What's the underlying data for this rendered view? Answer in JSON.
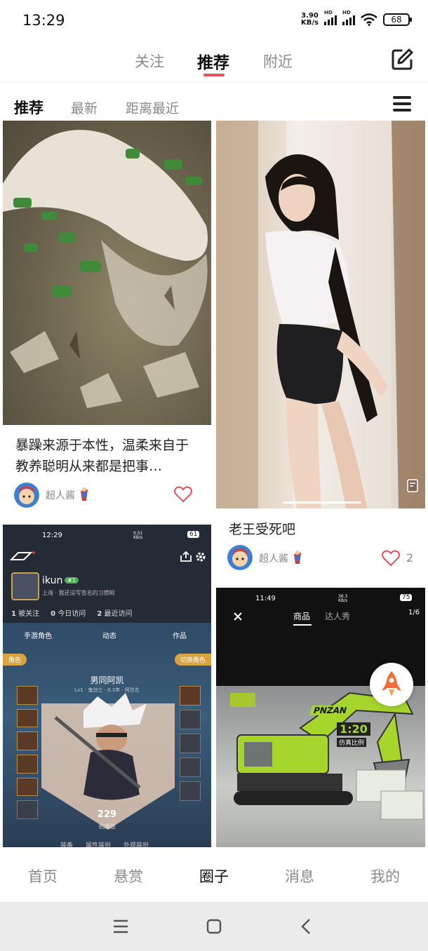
{
  "status_bar": {
    "time": "13:29",
    "net_speed_value": "3.90",
    "net_speed_unit": "KB/s",
    "hd_label": "HD",
    "battery": "68"
  },
  "top_tabs": [
    {
      "label": "关注"
    },
    {
      "label": "推荐"
    },
    {
      "label": "附近"
    }
  ],
  "sub_tabs": [
    {
      "label": "推荐"
    },
    {
      "label": "最新"
    },
    {
      "label": "距离最近"
    }
  ],
  "accent_color": "#e8505b",
  "cards": [
    {
      "title": "暴躁来源于本性，温柔来自于教养聪明从来都是把事…",
      "author": "超人酱",
      "likes": ""
    },
    {
      "title": "老王受死吧",
      "author": "超人酱",
      "likes": "2"
    },
    {
      "screenshot": {
        "time": "12:29",
        "speed": "0.51",
        "speed_unit": "KB/s",
        "battery": "61",
        "username": "ikun",
        "level": "#1",
        "bio": "上海 · 我还没写签名的习惯哟",
        "stats": [
          {
            "num": "1",
            "label": "被关注"
          },
          {
            "num": "0",
            "label": "今日访问"
          },
          {
            "num": "2",
            "label": "最近访问"
          }
        ],
        "tabs": [
          "手游角色",
          "动态",
          "作品"
        ],
        "left_chip": "角色",
        "right_chip": "切换角色",
        "char_name": "男同阿凯",
        "char_sub": "Lv1 · 鬼剑士 · 0.1年 · 阿甘左",
        "power": "229",
        "power_label": "抗魔值",
        "bottom_tabs": [
          "装备",
          "属性装扮",
          "外观装扮"
        ]
      }
    },
    {
      "screenshot": {
        "time": "11:49",
        "speed": "36.3",
        "speed_unit": "KB/s",
        "battery": "75",
        "tabs": [
          "商品",
          "达人秀"
        ],
        "pager": "1/6",
        "brand": "PNZAN",
        "scale": "1:20",
        "scale_label": "仿真比例"
      }
    }
  ],
  "bottom_nav": [
    {
      "label": "首页"
    },
    {
      "label": "悬赏"
    },
    {
      "label": "圈子"
    },
    {
      "label": "消息"
    },
    {
      "label": "我的"
    }
  ]
}
